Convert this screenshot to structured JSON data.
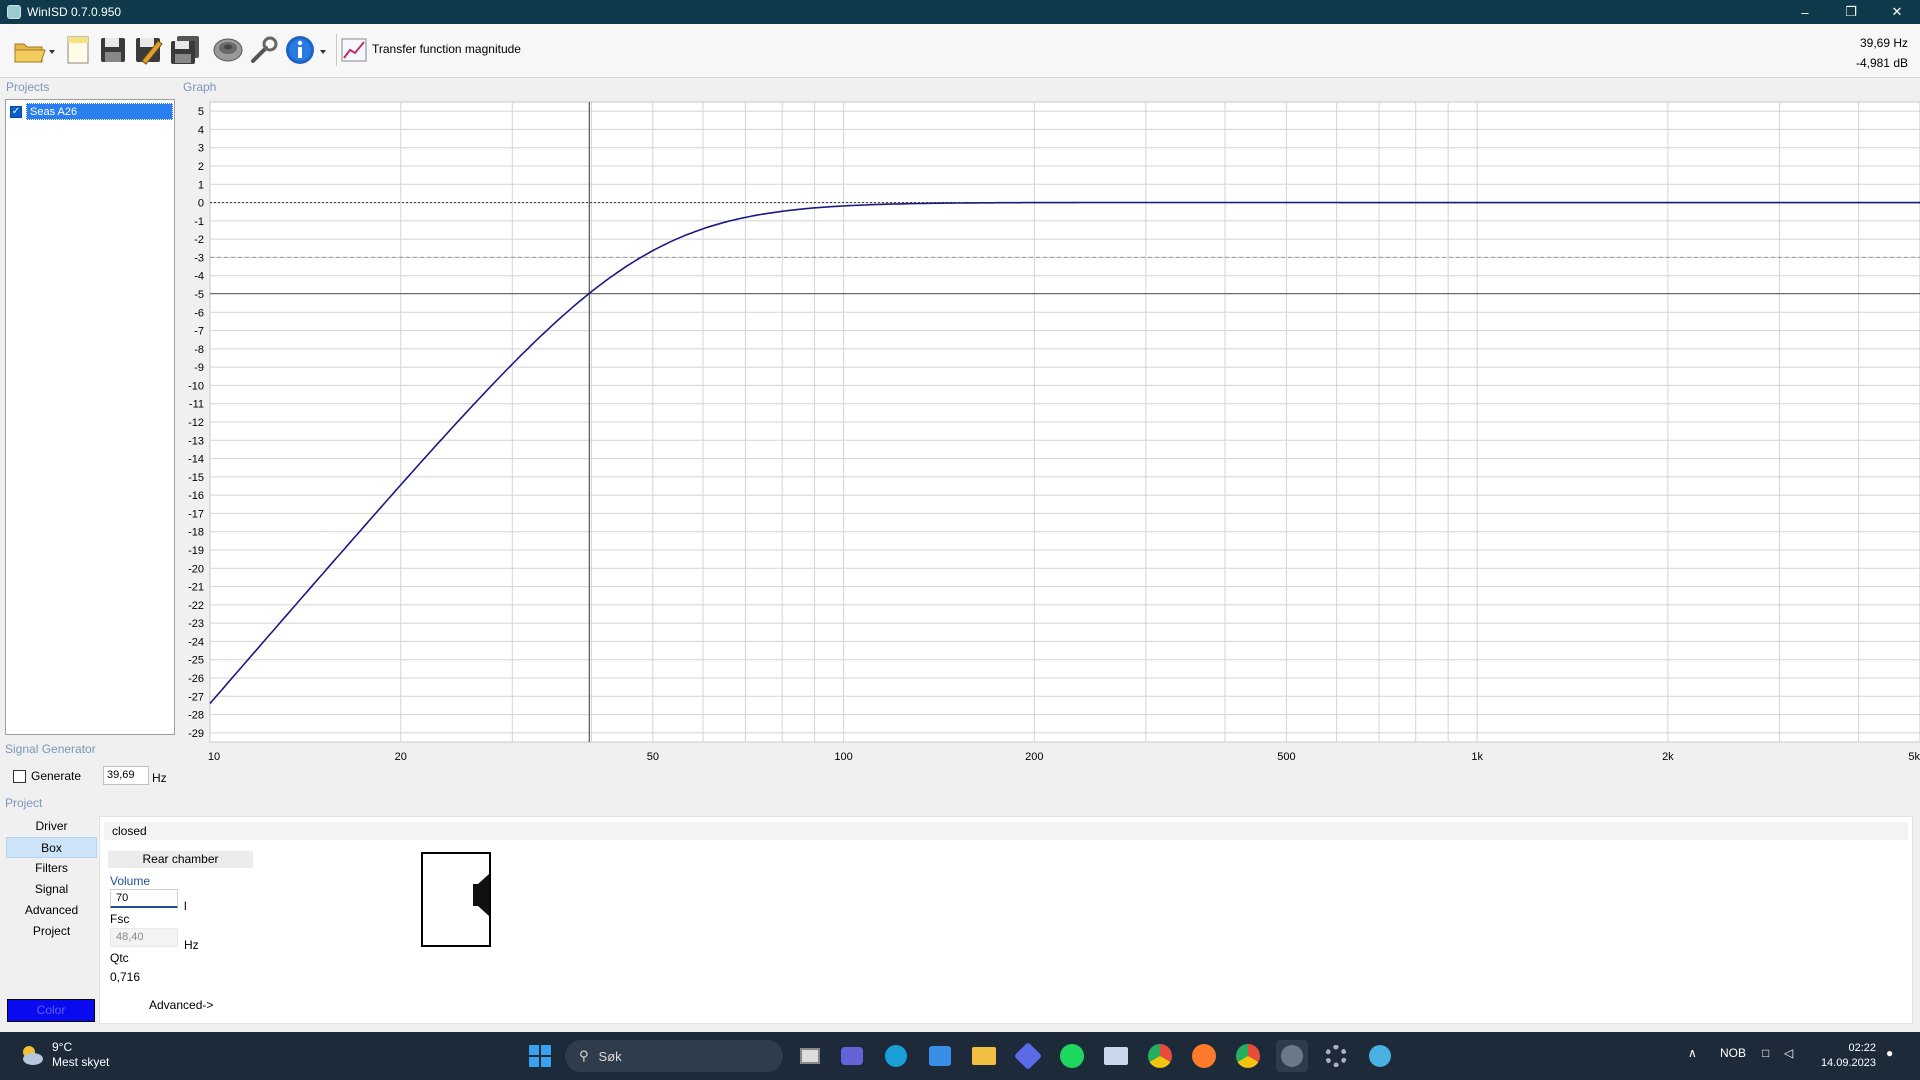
{
  "window": {
    "title": "WinISD 0.7.0.950"
  },
  "toolbar": {
    "graph_type_label": "Transfer function magnitude"
  },
  "readout": {
    "frequency": "39,69 Hz",
    "level": "-4,981 dB"
  },
  "sections": {
    "projects": "Projects",
    "graph": "Graph",
    "signal_generator": "Signal Generator",
    "project": "Project"
  },
  "projects": [
    {
      "name": "Seas A26",
      "checked": true
    }
  ],
  "signal_generator": {
    "generate_label": "Generate",
    "frequency": "39,69",
    "unit": "Hz"
  },
  "nav": [
    "Driver",
    "Box",
    "Filters",
    "Signal",
    "Advanced",
    "Project"
  ],
  "nav_active": "Box",
  "color_button": "Color",
  "box": {
    "type": "closed",
    "rear_chamber": "Rear chamber",
    "volume_label": "Volume",
    "volume_value": "70",
    "volume_unit": "l",
    "fsc_label": "Fsc",
    "fsc_value": "48,40",
    "fsc_unit": "Hz",
    "qtc_label": "Qtc",
    "qtc_value": "0,716",
    "advanced_link": "Advanced->"
  },
  "chart_data": {
    "type": "line",
    "title": "",
    "xlabel": "",
    "ylabel": "",
    "x_scale": "log",
    "xlim": [
      10,
      5000
    ],
    "ylim": [
      -29.5,
      5.5
    ],
    "x_ticks": [
      10,
      20,
      50,
      100,
      200,
      500,
      1000,
      2000,
      5000
    ],
    "x_tick_labels": [
      "10",
      "20",
      "50",
      "100",
      "200",
      "500",
      "1k",
      "2k",
      "5k"
    ],
    "y_ticks": [
      5,
      4,
      3,
      2,
      1,
      0,
      -1,
      -2,
      -3,
      -4,
      -5,
      -6,
      -7,
      -8,
      -9,
      -10,
      -11,
      -12,
      -13,
      -14,
      -15,
      -16,
      -17,
      -18,
      -19,
      -20,
      -21,
      -22,
      -23,
      -24,
      -25,
      -26,
      -27,
      -28,
      -29
    ],
    "grid": true,
    "reference_lines": [
      {
        "y": 0,
        "style": "dotted"
      },
      {
        "y": -3,
        "style": "dashed"
      }
    ],
    "cursor": {
      "x": 39.69,
      "y": -4.981
    },
    "series": [
      {
        "color": "#1a1a80",
        "fc": 48.4,
        "qtc": 0.716,
        "x": [
          10,
          12,
          15,
          20,
          25,
          30,
          35,
          39.69,
          45,
          50,
          60,
          70,
          80,
          100,
          120,
          150,
          200,
          500,
          1000,
          2000,
          5000
        ],
        "y": [
          -27.3,
          -22.8,
          -18.2,
          -15.0,
          -11.3,
          -8.9,
          -6.6,
          -4.98,
          -3.5,
          -2.5,
          -1.35,
          -0.8,
          -0.5,
          -0.2,
          -0.1,
          -0.05,
          0,
          0,
          0,
          0,
          0
        ]
      }
    ],
    "colors": {
      "curve": "#1a1a80",
      "grid": "#d4d4d4",
      "cursor": "#555555"
    }
  }
}
